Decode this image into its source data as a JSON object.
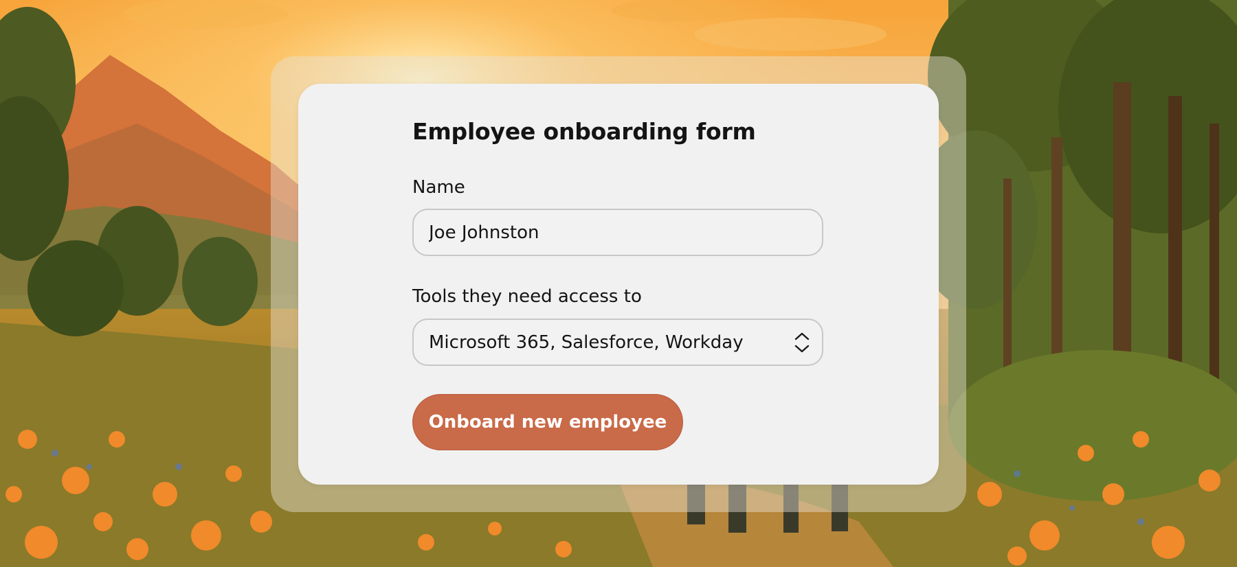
{
  "form": {
    "title": "Employee onboarding form",
    "name_label": "Name",
    "name_value": "Joe Johnston",
    "tools_label": "Tools they need access to",
    "tools_selected": "Microsoft 365, Salesforce, Workday",
    "submit_label": "Onboard new employee"
  },
  "icons": {
    "select_stepper": "chevron-up-down-icon"
  },
  "colors": {
    "button": "#c96a48",
    "card": "#f1f1f1",
    "text": "#141414"
  }
}
